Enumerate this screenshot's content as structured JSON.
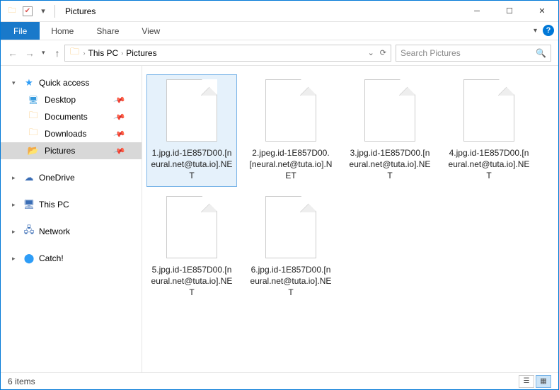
{
  "title": "Pictures",
  "ribbon": {
    "file": "File",
    "tabs": [
      "Home",
      "Share",
      "View"
    ]
  },
  "breadcrumbs": [
    "This PC",
    "Pictures"
  ],
  "search_placeholder": "Search Pictures",
  "navpane": {
    "quick_access": {
      "label": "Quick access",
      "items": [
        {
          "label": "Desktop",
          "pinned": true,
          "icon": "desktop"
        },
        {
          "label": "Documents",
          "pinned": true,
          "icon": "folder"
        },
        {
          "label": "Downloads",
          "pinned": true,
          "icon": "folder"
        },
        {
          "label": "Pictures",
          "pinned": true,
          "icon": "folderopen",
          "selected": true
        }
      ]
    },
    "roots": [
      {
        "label": "OneDrive",
        "icon": "cloud"
      },
      {
        "label": "This PC",
        "icon": "pc"
      },
      {
        "label": "Network",
        "icon": "net"
      },
      {
        "label": "Catch!",
        "icon": "catch"
      }
    ]
  },
  "files": [
    {
      "name": "1.jpg.id-1E857D00.[neural.net@tuta.io].NET",
      "selected": true
    },
    {
      "name": "2.jpeg.id-1E857D00.[neural.net@tuta.io].NET"
    },
    {
      "name": "3.jpg.id-1E857D00.[neural.net@tuta.io].NET"
    },
    {
      "name": "4.jpg.id-1E857D00.[neural.net@tuta.io].NET"
    },
    {
      "name": "5.jpg.id-1E857D00.[neural.net@tuta.io].NET"
    },
    {
      "name": "6.jpg.id-1E857D00.[neural.net@tuta.io].NET"
    }
  ],
  "status": {
    "item_count": "6 items"
  }
}
